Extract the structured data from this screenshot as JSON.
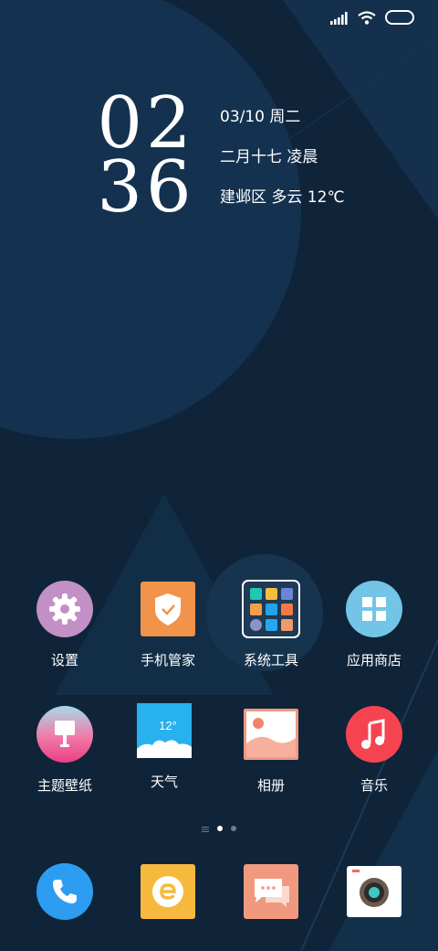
{
  "status_bar": {
    "signal_icon": "signal-bars-icon",
    "wifi_icon": "wifi-icon",
    "battery_icon": "battery-icon"
  },
  "clock": {
    "hours": "02",
    "minutes": "36"
  },
  "date_info": {
    "date": "03/10 周二",
    "lunar": "二月十七  凌晨",
    "weather": "建邺区 多云 12℃"
  },
  "apps_row1": [
    {
      "label": "设置",
      "icon": "settings-gear-icon"
    },
    {
      "label": "手机管家",
      "icon": "phone-manager-shield-icon"
    },
    {
      "label": "系统工具",
      "icon": "system-tools-folder-icon"
    },
    {
      "label": "应用商店",
      "icon": "app-store-grid-icon"
    }
  ],
  "apps_row2": [
    {
      "label": "主题壁纸",
      "icon": "theme-wallpaper-icon"
    },
    {
      "label": "天气",
      "icon": "weather-icon",
      "temperature": "12°"
    },
    {
      "label": "相册",
      "icon": "gallery-icon"
    },
    {
      "label": "音乐",
      "icon": "music-note-icon"
    }
  ],
  "pager": {
    "pages": 3,
    "current": 2
  },
  "dock": [
    {
      "name": "phone",
      "icon": "phone-icon"
    },
    {
      "name": "browser",
      "icon": "browser-e-icon"
    },
    {
      "name": "messages",
      "icon": "messages-icon"
    },
    {
      "name": "camera",
      "icon": "camera-icon"
    }
  ]
}
